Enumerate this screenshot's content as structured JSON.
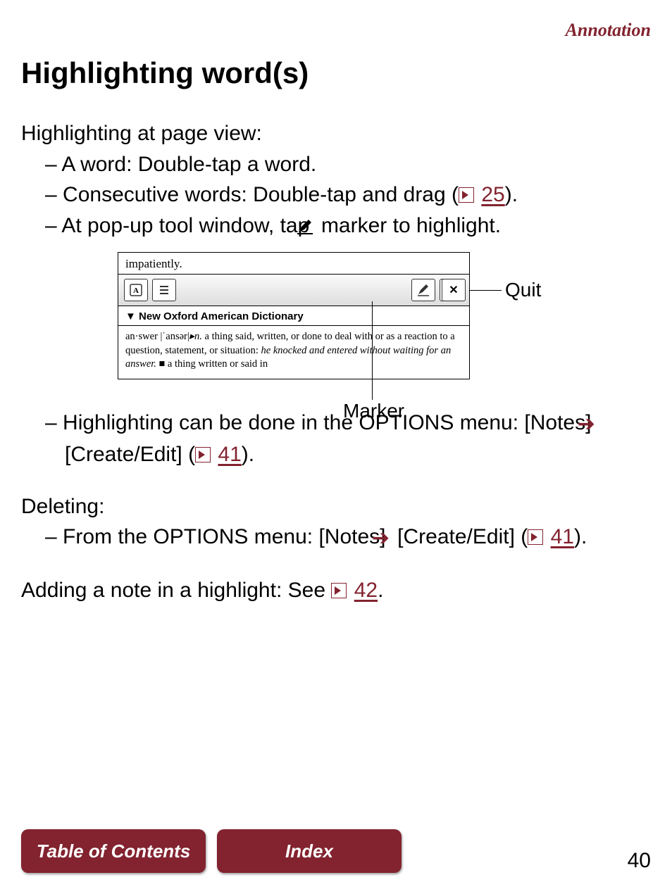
{
  "cornerLabel": "Annotation",
  "title": "Highlighting word(s)",
  "intro": "Highlighting at page view:",
  "bullets": {
    "b1": "A word: Double-tap a word.",
    "b2a": "Consecutive words: Double-tap and drag (",
    "b2link": "25",
    "b2b": ").",
    "b3a": "At pop-up tool window, tap ",
    "b3b": " marker to highlight."
  },
  "diagram": {
    "topWord": "impatiently.",
    "dictTitle": "▼ New Oxford American Dictionary",
    "dictBody": {
      "headword": "an·swer",
      "pron": "|ˈansər|",
      "pos": "▸n.",
      "def1a": "   a thing said, written, or done to deal with or as a reaction to a question, statement, or situation: ",
      "ex1": "he knocked and entered without waiting for an answer.",
      "def1b": "   ■ a thing written or said in"
    },
    "quitLabel": "Quit",
    "markerLabel": "Marker",
    "closeBtn": "✕"
  },
  "afterDiagram": {
    "l1a": "Highlighting can be done in the OPTIONS menu: [Notes] ",
    "l1b": " [Create/Edit] (",
    "l1link": "41",
    "l1c": ")."
  },
  "deleting": {
    "head": "Deleting:",
    "l1a": "From the OPTIONS menu: [Notes] ",
    "l1b": " [Create/Edit] (",
    "l1link": "41",
    "l1c": ")."
  },
  "adding": {
    "a": "Adding a note in a highlight: See ",
    "link": "42",
    "b": "."
  },
  "footer": {
    "toc": "Table of Contents",
    "index": "Index",
    "page": "40"
  }
}
